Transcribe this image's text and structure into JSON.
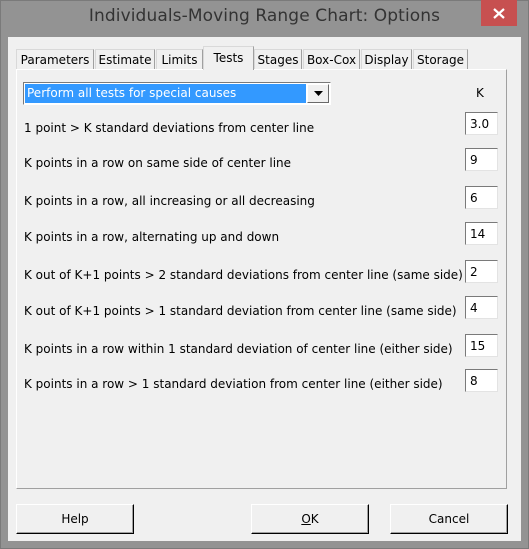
{
  "window": {
    "title": "Individuals-Moving Range Chart: Options",
    "close_icon": "close-icon"
  },
  "tabs": [
    {
      "label": "Parameters",
      "active": false
    },
    {
      "label": "Estimate",
      "active": false
    },
    {
      "label": "Limits",
      "active": false
    },
    {
      "label": "Tests",
      "active": true
    },
    {
      "label": "Stages",
      "active": false
    },
    {
      "label": "Box-Cox",
      "active": false
    },
    {
      "label": "Display",
      "active": false
    },
    {
      "label": "Storage",
      "active": false
    }
  ],
  "tests": {
    "dropdown_value": "Perform all tests for special causes",
    "k_header": "K",
    "rows": [
      {
        "label": "1 point > K standard deviations from center line",
        "k": "3.0"
      },
      {
        "label": "K points in a row on same side of center line",
        "k": "9"
      },
      {
        "label": "K points in a row, all increasing or all decreasing",
        "k": "6"
      },
      {
        "label": "K points in a row, alternating up and down",
        "k": "14"
      },
      {
        "label": "K out of K+1 points > 2 standard deviations from center line (same side)",
        "k": "2"
      },
      {
        "label": "K out of K+1 points > 1 standard deviation from center line (same side)",
        "k": "4"
      },
      {
        "label": "K points in a row within 1 standard deviation of center line (either side)",
        "k": "15"
      },
      {
        "label": "K points in a row > 1 standard deviation from center line (either side)",
        "k": "8"
      }
    ]
  },
  "buttons": {
    "help": "Help",
    "ok_mnemonic": "O",
    "ok_rest": "K",
    "cancel": "Cancel"
  },
  "colors": {
    "selection": "#3399ff",
    "close_button": "#c75050"
  }
}
